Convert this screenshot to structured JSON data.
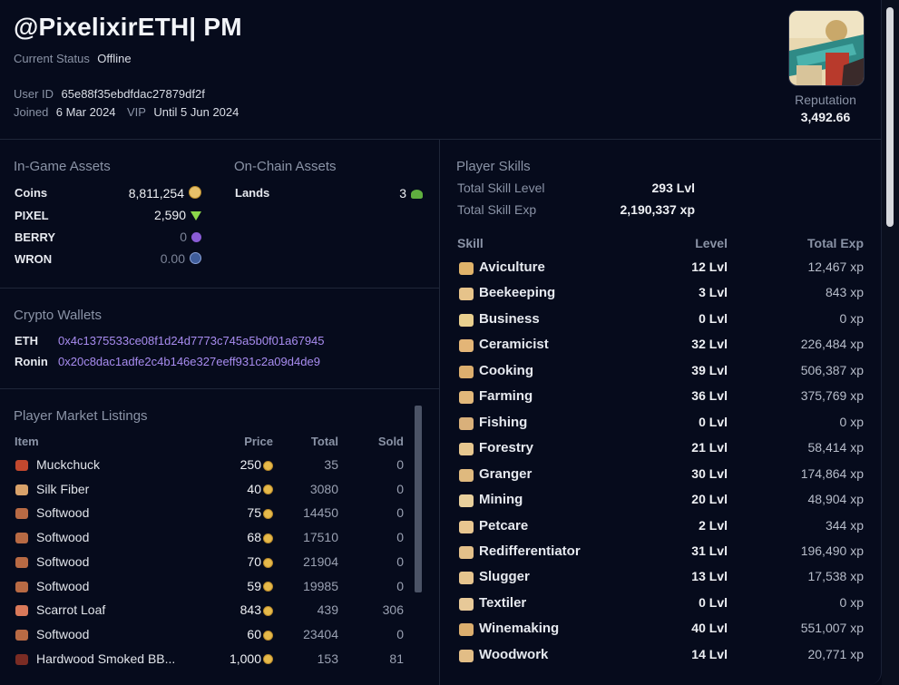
{
  "header": {
    "title": "@PixelixirETH| PM",
    "status_label": "Current Status",
    "status_value": "Offline",
    "user_id_label": "User ID",
    "user_id": "65e88f35ebdfdac27879df2f",
    "joined_label": "Joined",
    "joined": "6 Mar 2024",
    "vip_label": "VIP",
    "vip": "Until 5 Jun 2024",
    "reputation_label": "Reputation",
    "reputation": "3,492.66"
  },
  "ingame_assets": {
    "title": "In-Game Assets",
    "rows": [
      {
        "label": "Coins",
        "value": "8,811,254",
        "icon": "coin-icon"
      },
      {
        "label": "PIXEL",
        "value": "2,590",
        "icon": "pixel-gem-icon"
      },
      {
        "label": "BERRY",
        "value": "0",
        "icon": "berry-icon"
      },
      {
        "label": "WRON",
        "value": "0.00",
        "icon": "wron-icon"
      }
    ]
  },
  "onchain_assets": {
    "title": "On-Chain Assets",
    "rows": [
      {
        "label": "Lands",
        "value": "3",
        "icon": "tree-icon"
      }
    ]
  },
  "wallets": {
    "title": "Crypto Wallets",
    "rows": [
      {
        "label": "ETH",
        "address": "0x4c1375533ce08f1d24d7773c745a5b0f01a67945"
      },
      {
        "label": "Ronin",
        "address": "0x20c8dac1adfe2c4b146e327eeff931c2a09d4de9"
      }
    ]
  },
  "market": {
    "title": "Player Market Listings",
    "columns": [
      "Item",
      "Price",
      "Total",
      "Sold"
    ],
    "rows": [
      {
        "item": "Muckchuck",
        "price": "250",
        "total": "35",
        "sold": "0",
        "color": "#c2482e"
      },
      {
        "item": "Silk Fiber",
        "price": "40",
        "total": "3080",
        "sold": "0",
        "color": "#d9a26a"
      },
      {
        "item": "Softwood",
        "price": "75",
        "total": "14450",
        "sold": "0",
        "color": "#b86a44"
      },
      {
        "item": "Softwood",
        "price": "68",
        "total": "17510",
        "sold": "0",
        "color": "#b86a44"
      },
      {
        "item": "Softwood",
        "price": "70",
        "total": "21904",
        "sold": "0",
        "color": "#b86a44"
      },
      {
        "item": "Softwood",
        "price": "59",
        "total": "19985",
        "sold": "0",
        "color": "#b86a44"
      },
      {
        "item": "Scarrot Loaf",
        "price": "843",
        "total": "439",
        "sold": "306",
        "color": "#d9795a"
      },
      {
        "item": "Softwood",
        "price": "60",
        "total": "23404",
        "sold": "0",
        "color": "#b86a44"
      },
      {
        "item": "Hardwood Smoked BB...",
        "price": "1,000",
        "total": "153",
        "sold": "81",
        "color": "#7a2c24"
      }
    ]
  },
  "skills": {
    "title": "Player Skills",
    "total_level_label": "Total Skill Level",
    "total_level": "293 Lvl",
    "total_exp_label": "Total Skill Exp",
    "total_exp": "2,190,337 xp",
    "columns": [
      "Skill",
      "Level",
      "Total Exp"
    ],
    "rows": [
      {
        "name": "Aviculture",
        "level": "12 Lvl",
        "xp": "12,467 xp",
        "icon": "bird-icon",
        "color": "#e0b36a"
      },
      {
        "name": "Beekeeping",
        "level": "3 Lvl",
        "xp": "843 xp",
        "icon": "bee-icon",
        "color": "#e6c38a"
      },
      {
        "name": "Business",
        "level": "0 Lvl",
        "xp": "0 xp",
        "icon": "briefcase-icon",
        "color": "#e9cf8e"
      },
      {
        "name": "Ceramicist",
        "level": "32 Lvl",
        "xp": "226,484 xp",
        "icon": "vase-icon",
        "color": "#e3b577"
      },
      {
        "name": "Cooking",
        "level": "39 Lvl",
        "xp": "506,387 xp",
        "icon": "pot-icon",
        "color": "#dcae6e"
      },
      {
        "name": "Farming",
        "level": "36 Lvl",
        "xp": "375,769 xp",
        "icon": "farm-icon",
        "color": "#e2b87a"
      },
      {
        "name": "Fishing",
        "level": "0 Lvl",
        "xp": "0 xp",
        "icon": "fish-icon",
        "color": "#d9b07a"
      },
      {
        "name": "Forestry",
        "level": "21 Lvl",
        "xp": "58,414 xp",
        "icon": "tree-icon",
        "color": "#e7c78f"
      },
      {
        "name": "Granger",
        "level": "30 Lvl",
        "xp": "174,864 xp",
        "icon": "grain-icon",
        "color": "#dfb97e"
      },
      {
        "name": "Mining",
        "level": "20 Lvl",
        "xp": "48,904 xp",
        "icon": "pickaxe-icon",
        "color": "#e8cf9c"
      },
      {
        "name": "Petcare",
        "level": "2 Lvl",
        "xp": "344 xp",
        "icon": "paw-icon",
        "color": "#e8c690"
      },
      {
        "name": "Redifferentiator",
        "level": "31 Lvl",
        "xp": "196,490 xp",
        "icon": "recycle-icon",
        "color": "#e3c08a"
      },
      {
        "name": "Slugger",
        "level": "13 Lvl",
        "xp": "17,538 xp",
        "icon": "slug-icon",
        "color": "#e6c48e"
      },
      {
        "name": "Textiler",
        "level": "0 Lvl",
        "xp": "0 xp",
        "icon": "textile-icon",
        "color": "#e7c998"
      },
      {
        "name": "Winemaking",
        "level": "40 Lvl",
        "xp": "551,007 xp",
        "icon": "wine-icon",
        "color": "#dcae6e"
      },
      {
        "name": "Woodwork",
        "level": "14 Lvl",
        "xp": "20,771 xp",
        "icon": "chair-icon",
        "color": "#e2bd86"
      }
    ]
  }
}
